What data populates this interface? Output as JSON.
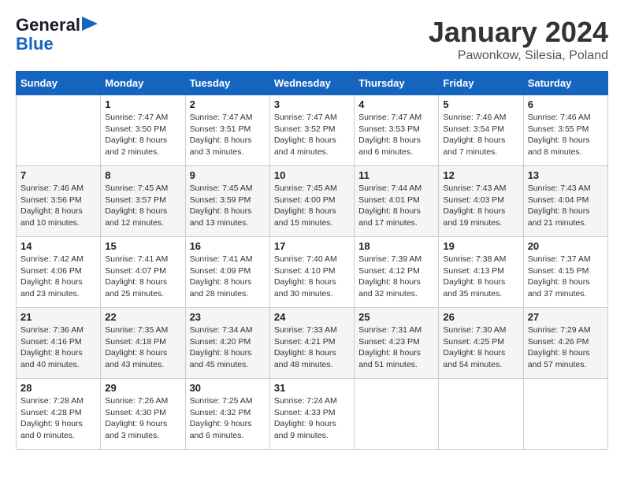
{
  "header": {
    "logo_line1": "General",
    "logo_line2": "Blue",
    "title": "January 2024",
    "subtitle": "Pawonkow, Silesia, Poland"
  },
  "calendar": {
    "days_of_week": [
      "Sunday",
      "Monday",
      "Tuesday",
      "Wednesday",
      "Thursday",
      "Friday",
      "Saturday"
    ],
    "weeks": [
      [
        {
          "day": "",
          "info": ""
        },
        {
          "day": "1",
          "info": "Sunrise: 7:47 AM\nSunset: 3:50 PM\nDaylight: 8 hours\nand 2 minutes."
        },
        {
          "day": "2",
          "info": "Sunrise: 7:47 AM\nSunset: 3:51 PM\nDaylight: 8 hours\nand 3 minutes."
        },
        {
          "day": "3",
          "info": "Sunrise: 7:47 AM\nSunset: 3:52 PM\nDaylight: 8 hours\nand 4 minutes."
        },
        {
          "day": "4",
          "info": "Sunrise: 7:47 AM\nSunset: 3:53 PM\nDaylight: 8 hours\nand 6 minutes."
        },
        {
          "day": "5",
          "info": "Sunrise: 7:46 AM\nSunset: 3:54 PM\nDaylight: 8 hours\nand 7 minutes."
        },
        {
          "day": "6",
          "info": "Sunrise: 7:46 AM\nSunset: 3:55 PM\nDaylight: 8 hours\nand 8 minutes."
        }
      ],
      [
        {
          "day": "7",
          "info": "Sunrise: 7:46 AM\nSunset: 3:56 PM\nDaylight: 8 hours\nand 10 minutes."
        },
        {
          "day": "8",
          "info": "Sunrise: 7:45 AM\nSunset: 3:57 PM\nDaylight: 8 hours\nand 12 minutes."
        },
        {
          "day": "9",
          "info": "Sunrise: 7:45 AM\nSunset: 3:59 PM\nDaylight: 8 hours\nand 13 minutes."
        },
        {
          "day": "10",
          "info": "Sunrise: 7:45 AM\nSunset: 4:00 PM\nDaylight: 8 hours\nand 15 minutes."
        },
        {
          "day": "11",
          "info": "Sunrise: 7:44 AM\nSunset: 4:01 PM\nDaylight: 8 hours\nand 17 minutes."
        },
        {
          "day": "12",
          "info": "Sunrise: 7:43 AM\nSunset: 4:03 PM\nDaylight: 8 hours\nand 19 minutes."
        },
        {
          "day": "13",
          "info": "Sunrise: 7:43 AM\nSunset: 4:04 PM\nDaylight: 8 hours\nand 21 minutes."
        }
      ],
      [
        {
          "day": "14",
          "info": "Sunrise: 7:42 AM\nSunset: 4:06 PM\nDaylight: 8 hours\nand 23 minutes."
        },
        {
          "day": "15",
          "info": "Sunrise: 7:41 AM\nSunset: 4:07 PM\nDaylight: 8 hours\nand 25 minutes."
        },
        {
          "day": "16",
          "info": "Sunrise: 7:41 AM\nSunset: 4:09 PM\nDaylight: 8 hours\nand 28 minutes."
        },
        {
          "day": "17",
          "info": "Sunrise: 7:40 AM\nSunset: 4:10 PM\nDaylight: 8 hours\nand 30 minutes."
        },
        {
          "day": "18",
          "info": "Sunrise: 7:39 AM\nSunset: 4:12 PM\nDaylight: 8 hours\nand 32 minutes."
        },
        {
          "day": "19",
          "info": "Sunrise: 7:38 AM\nSunset: 4:13 PM\nDaylight: 8 hours\nand 35 minutes."
        },
        {
          "day": "20",
          "info": "Sunrise: 7:37 AM\nSunset: 4:15 PM\nDaylight: 8 hours\nand 37 minutes."
        }
      ],
      [
        {
          "day": "21",
          "info": "Sunrise: 7:36 AM\nSunset: 4:16 PM\nDaylight: 8 hours\nand 40 minutes."
        },
        {
          "day": "22",
          "info": "Sunrise: 7:35 AM\nSunset: 4:18 PM\nDaylight: 8 hours\nand 43 minutes."
        },
        {
          "day": "23",
          "info": "Sunrise: 7:34 AM\nSunset: 4:20 PM\nDaylight: 8 hours\nand 45 minutes."
        },
        {
          "day": "24",
          "info": "Sunrise: 7:33 AM\nSunset: 4:21 PM\nDaylight: 8 hours\nand 48 minutes."
        },
        {
          "day": "25",
          "info": "Sunrise: 7:31 AM\nSunset: 4:23 PM\nDaylight: 8 hours\nand 51 minutes."
        },
        {
          "day": "26",
          "info": "Sunrise: 7:30 AM\nSunset: 4:25 PM\nDaylight: 8 hours\nand 54 minutes."
        },
        {
          "day": "27",
          "info": "Sunrise: 7:29 AM\nSunset: 4:26 PM\nDaylight: 8 hours\nand 57 minutes."
        }
      ],
      [
        {
          "day": "28",
          "info": "Sunrise: 7:28 AM\nSunset: 4:28 PM\nDaylight: 9 hours\nand 0 minutes."
        },
        {
          "day": "29",
          "info": "Sunrise: 7:26 AM\nSunset: 4:30 PM\nDaylight: 9 hours\nand 3 minutes."
        },
        {
          "day": "30",
          "info": "Sunrise: 7:25 AM\nSunset: 4:32 PM\nDaylight: 9 hours\nand 6 minutes."
        },
        {
          "day": "31",
          "info": "Sunrise: 7:24 AM\nSunset: 4:33 PM\nDaylight: 9 hours\nand 9 minutes."
        },
        {
          "day": "",
          "info": ""
        },
        {
          "day": "",
          "info": ""
        },
        {
          "day": "",
          "info": ""
        }
      ]
    ]
  }
}
